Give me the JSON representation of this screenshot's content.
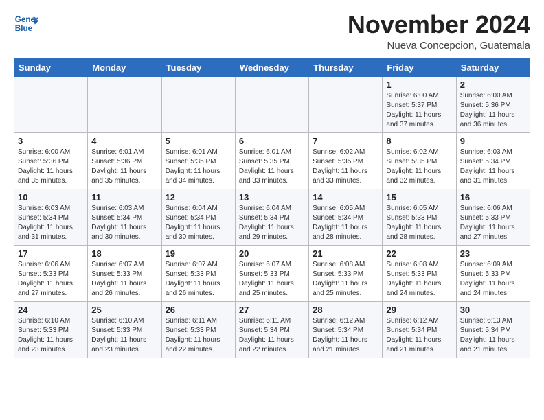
{
  "header": {
    "logo_line1": "General",
    "logo_line2": "Blue",
    "month": "November 2024",
    "location": "Nueva Concepcion, Guatemala"
  },
  "weekdays": [
    "Sunday",
    "Monday",
    "Tuesday",
    "Wednesday",
    "Thursday",
    "Friday",
    "Saturday"
  ],
  "weeks": [
    [
      {
        "day": "",
        "info": ""
      },
      {
        "day": "",
        "info": ""
      },
      {
        "day": "",
        "info": ""
      },
      {
        "day": "",
        "info": ""
      },
      {
        "day": "",
        "info": ""
      },
      {
        "day": "1",
        "info": "Sunrise: 6:00 AM\nSunset: 5:37 PM\nDaylight: 11 hours\nand 37 minutes."
      },
      {
        "day": "2",
        "info": "Sunrise: 6:00 AM\nSunset: 5:36 PM\nDaylight: 11 hours\nand 36 minutes."
      }
    ],
    [
      {
        "day": "3",
        "info": "Sunrise: 6:00 AM\nSunset: 5:36 PM\nDaylight: 11 hours\nand 35 minutes."
      },
      {
        "day": "4",
        "info": "Sunrise: 6:01 AM\nSunset: 5:36 PM\nDaylight: 11 hours\nand 35 minutes."
      },
      {
        "day": "5",
        "info": "Sunrise: 6:01 AM\nSunset: 5:35 PM\nDaylight: 11 hours\nand 34 minutes."
      },
      {
        "day": "6",
        "info": "Sunrise: 6:01 AM\nSunset: 5:35 PM\nDaylight: 11 hours\nand 33 minutes."
      },
      {
        "day": "7",
        "info": "Sunrise: 6:02 AM\nSunset: 5:35 PM\nDaylight: 11 hours\nand 33 minutes."
      },
      {
        "day": "8",
        "info": "Sunrise: 6:02 AM\nSunset: 5:35 PM\nDaylight: 11 hours\nand 32 minutes."
      },
      {
        "day": "9",
        "info": "Sunrise: 6:03 AM\nSunset: 5:34 PM\nDaylight: 11 hours\nand 31 minutes."
      }
    ],
    [
      {
        "day": "10",
        "info": "Sunrise: 6:03 AM\nSunset: 5:34 PM\nDaylight: 11 hours\nand 31 minutes."
      },
      {
        "day": "11",
        "info": "Sunrise: 6:03 AM\nSunset: 5:34 PM\nDaylight: 11 hours\nand 30 minutes."
      },
      {
        "day": "12",
        "info": "Sunrise: 6:04 AM\nSunset: 5:34 PM\nDaylight: 11 hours\nand 30 minutes."
      },
      {
        "day": "13",
        "info": "Sunrise: 6:04 AM\nSunset: 5:34 PM\nDaylight: 11 hours\nand 29 minutes."
      },
      {
        "day": "14",
        "info": "Sunrise: 6:05 AM\nSunset: 5:34 PM\nDaylight: 11 hours\nand 28 minutes."
      },
      {
        "day": "15",
        "info": "Sunrise: 6:05 AM\nSunset: 5:33 PM\nDaylight: 11 hours\nand 28 minutes."
      },
      {
        "day": "16",
        "info": "Sunrise: 6:06 AM\nSunset: 5:33 PM\nDaylight: 11 hours\nand 27 minutes."
      }
    ],
    [
      {
        "day": "17",
        "info": "Sunrise: 6:06 AM\nSunset: 5:33 PM\nDaylight: 11 hours\nand 27 minutes."
      },
      {
        "day": "18",
        "info": "Sunrise: 6:07 AM\nSunset: 5:33 PM\nDaylight: 11 hours\nand 26 minutes."
      },
      {
        "day": "19",
        "info": "Sunrise: 6:07 AM\nSunset: 5:33 PM\nDaylight: 11 hours\nand 26 minutes."
      },
      {
        "day": "20",
        "info": "Sunrise: 6:07 AM\nSunset: 5:33 PM\nDaylight: 11 hours\nand 25 minutes."
      },
      {
        "day": "21",
        "info": "Sunrise: 6:08 AM\nSunset: 5:33 PM\nDaylight: 11 hours\nand 25 minutes."
      },
      {
        "day": "22",
        "info": "Sunrise: 6:08 AM\nSunset: 5:33 PM\nDaylight: 11 hours\nand 24 minutes."
      },
      {
        "day": "23",
        "info": "Sunrise: 6:09 AM\nSunset: 5:33 PM\nDaylight: 11 hours\nand 24 minutes."
      }
    ],
    [
      {
        "day": "24",
        "info": "Sunrise: 6:10 AM\nSunset: 5:33 PM\nDaylight: 11 hours\nand 23 minutes."
      },
      {
        "day": "25",
        "info": "Sunrise: 6:10 AM\nSunset: 5:33 PM\nDaylight: 11 hours\nand 23 minutes."
      },
      {
        "day": "26",
        "info": "Sunrise: 6:11 AM\nSunset: 5:33 PM\nDaylight: 11 hours\nand 22 minutes."
      },
      {
        "day": "27",
        "info": "Sunrise: 6:11 AM\nSunset: 5:34 PM\nDaylight: 11 hours\nand 22 minutes."
      },
      {
        "day": "28",
        "info": "Sunrise: 6:12 AM\nSunset: 5:34 PM\nDaylight: 11 hours\nand 21 minutes."
      },
      {
        "day": "29",
        "info": "Sunrise: 6:12 AM\nSunset: 5:34 PM\nDaylight: 11 hours\nand 21 minutes."
      },
      {
        "day": "30",
        "info": "Sunrise: 6:13 AM\nSunset: 5:34 PM\nDaylight: 11 hours\nand 21 minutes."
      }
    ]
  ]
}
